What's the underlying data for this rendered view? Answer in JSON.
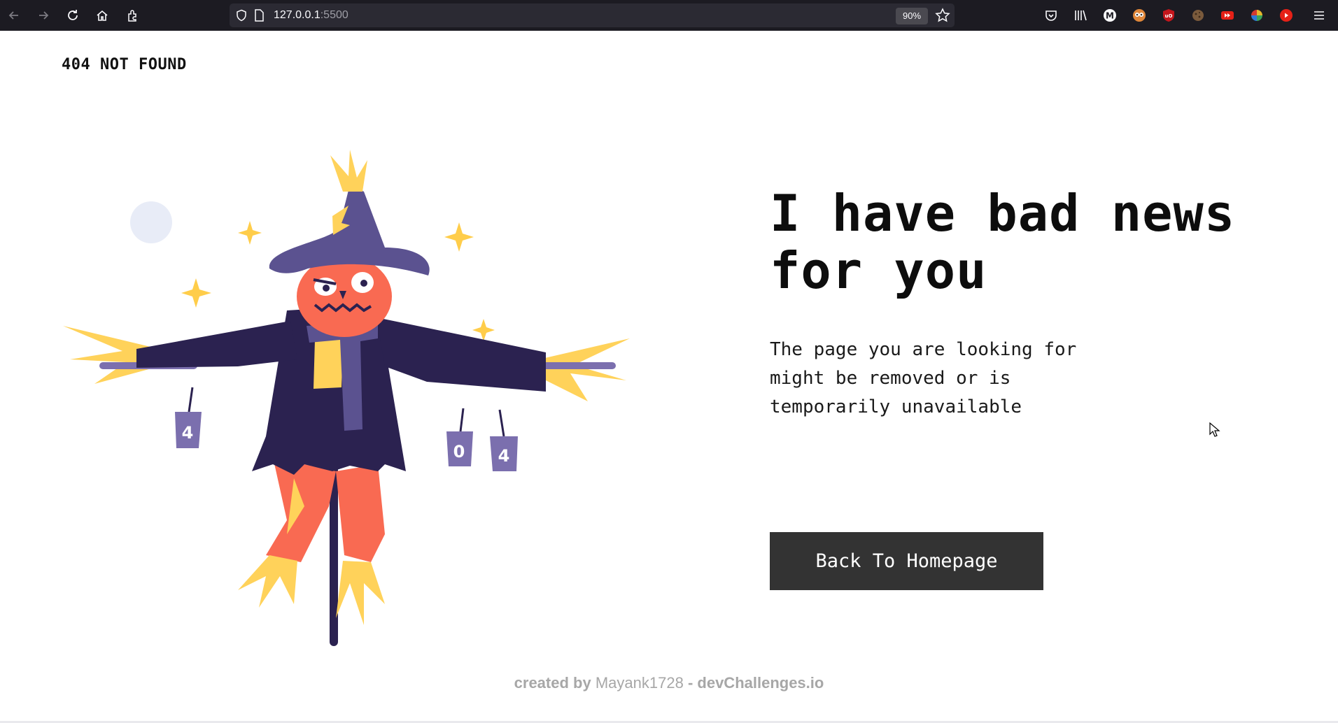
{
  "browser": {
    "url_host": "127.0.0.1",
    "url_port": ":5500",
    "zoom": "90%"
  },
  "page": {
    "brand": "404 NOT FOUND",
    "headline": "I have bad news for you",
    "body": "The page you are looking for might be removed or is temporarily unavailable",
    "button_label": "Back To Homepage",
    "footer": {
      "prefix": "created by",
      "author": "Mayank1728",
      "separator": "-",
      "site": "devChallenges.io"
    },
    "illustration_cans": [
      "4",
      "0",
      "4"
    ]
  },
  "colors": {
    "hat": "#5b5290",
    "face": "#f96a52",
    "coat": "#2b2250",
    "straw": "#ffd25a",
    "button_bg": "#333333"
  }
}
